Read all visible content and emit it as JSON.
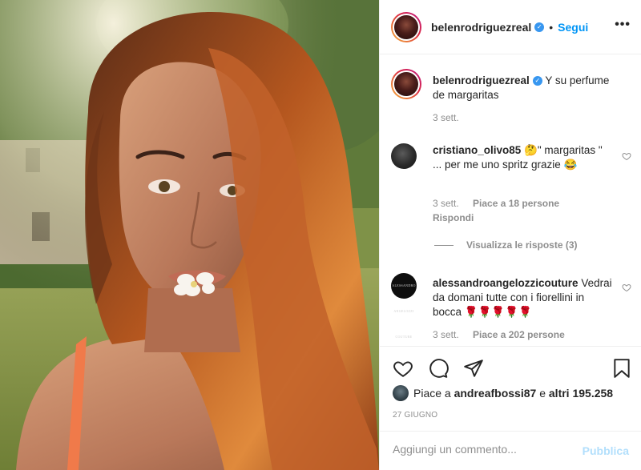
{
  "post": {
    "author": {
      "username": "belenrodriguezreal",
      "verified_mark": "✓",
      "separator": "•",
      "follow_label": "Segui",
      "more_label": "•••"
    },
    "caption": {
      "username": "belenrodriguezreal",
      "text": "Y su perfume de margaritas",
      "time": "3 sett."
    },
    "comments": [
      {
        "username": "cristiano_olivo85",
        "text": "🤔\" margaritas \" ... per me uno spritz grazie 😂",
        "time": "3 sett.",
        "likes": "Piace a 18 persone",
        "reply_label": "Rispondi",
        "view_replies": "Visualizza le risposte (3)"
      },
      {
        "username": "alessandroangelozzicouture",
        "avatar_text": "ALESSANDRO ANGELOZZI COUTURE",
        "text": "Vedrai da domani tutte con i fiorellini in bocca 🌹🌹🌹🌹🌹",
        "time": "3 sett.",
        "likes": "Piace a 202 persone"
      }
    ],
    "likes_summary": {
      "prefix": "Piace a",
      "user": "andreafbossi87",
      "connector": "e",
      "others": "altri 195.258"
    },
    "date": "27 GIUGNO",
    "add_comment": {
      "placeholder": "Aggiungi un commento...",
      "publish_label": "Pubblica"
    }
  },
  "colors": {
    "accent_blue": "#0095f6",
    "publish_disabled": "#b2dffc",
    "muted_text": "#8e8e8e",
    "border": "#efefef"
  },
  "icons": [
    "heart-icon",
    "comment-icon",
    "share-icon",
    "bookmark-icon",
    "verified-icon",
    "more-options-icon"
  ]
}
